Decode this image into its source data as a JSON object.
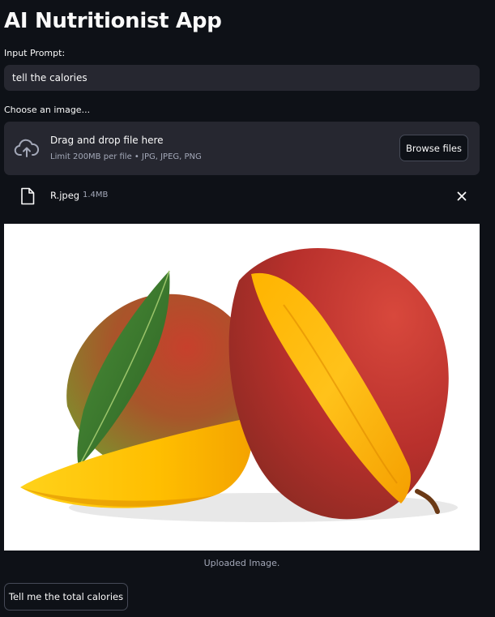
{
  "app": {
    "title": "AI Nutritionist App"
  },
  "prompt": {
    "label": "Input Prompt:",
    "value": "tell the calories"
  },
  "uploader": {
    "label": "Choose an image...",
    "dropzone_title": "Drag and drop file here",
    "dropzone_limit": "Limit 200MB per file • JPG, JPEG, PNG",
    "browse_label": "Browse files",
    "cloud_icon": "cloud-upload-icon"
  },
  "uploaded_file": {
    "name": "R.jpeg",
    "size": "1.4MB",
    "file_icon": "file-icon",
    "remove_icon": "close-icon"
  },
  "image": {
    "subject": "two mangoes with a slice and a green leaf",
    "caption": "Uploaded Image."
  },
  "actions": {
    "submit_label": "Tell me the total calories"
  },
  "colors": {
    "background": "#0e1117",
    "input_bg": "#262730",
    "border": "#464a57",
    "muted_text": "#a3a8b8"
  }
}
